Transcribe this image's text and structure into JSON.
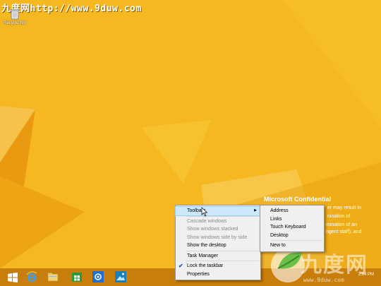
{
  "watermark": {
    "top_text": "九度网http://www.9duw.com",
    "logo_text": "九度网",
    "site_text": "www.9duw.com"
  },
  "desktop": {
    "recycle_bin_label": "Recycle Bin",
    "colors": {
      "background": "#f2b41c",
      "highlight_blue": "#cde8fb",
      "checkmark": "#1e5aa8"
    }
  },
  "overlay": {
    "confidential_title": "Microsoft Confidential",
    "fragments": [
      "er may result in",
      "nination of",
      "mination of an",
      "ngent staff), and"
    ]
  },
  "clock": {
    "time": "2:04 PM",
    "date": ""
  },
  "context_menu": {
    "items": [
      {
        "label": "Toolbars",
        "state": "highlighted",
        "has_submenu": true
      },
      {
        "label": "Cascade windows",
        "state": "disabled"
      },
      {
        "label": "Show windows stacked",
        "state": "disabled"
      },
      {
        "label": "Show windows side by side",
        "state": "disabled"
      },
      {
        "label": "Show the desktop",
        "state": "normal"
      },
      {
        "label": "Task Manager",
        "state": "normal"
      },
      {
        "label": "Lock the taskbar",
        "state": "checked"
      },
      {
        "label": "Properties",
        "state": "normal"
      }
    ]
  },
  "submenu": {
    "items": [
      "Address",
      "Links",
      "Touch Keyboard",
      "Desktop",
      "New to"
    ]
  },
  "taskbar": {
    "buttons": [
      "start-icon",
      "internet-explorer-icon",
      "file-explorer-icon",
      "store-icon",
      "settings-icon",
      "photos-icon"
    ]
  }
}
